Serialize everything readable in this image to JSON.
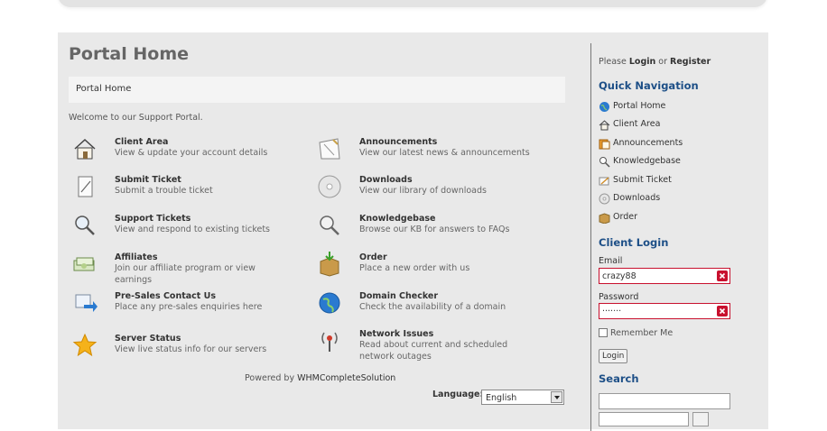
{
  "main": {
    "title": "Portal Home",
    "breadcrumb": "Portal Home",
    "welcome": "Welcome to our Support Portal.",
    "features": [
      {
        "title": "Client Area",
        "desc": "View & update your account details",
        "icon": "house-icon"
      },
      {
        "title": "Announcements",
        "desc": "View our latest news & announcements",
        "icon": "announcement-icon"
      },
      {
        "title": "Submit Ticket",
        "desc": "Submit a trouble ticket",
        "icon": "notepad-icon"
      },
      {
        "title": "Downloads",
        "desc": "View our library of downloads",
        "icon": "disc-icon"
      },
      {
        "title": "Support Tickets",
        "desc": "View and respond to existing tickets",
        "icon": "magnifier-icon"
      },
      {
        "title": "Knowledgebase",
        "desc": "Browse our KB for answers to FAQs",
        "icon": "magnifier-icon"
      },
      {
        "title": "Affiliates",
        "desc": "Join our affiliate program or view earnings",
        "icon": "money-icon"
      },
      {
        "title": "Order",
        "desc": "Place a new order with us",
        "icon": "package-icon"
      },
      {
        "title": "Pre-Sales Contact Us",
        "desc": "Place any pre-sales enquiries here",
        "icon": "send-icon"
      },
      {
        "title": "Domain Checker",
        "desc": "Check the availability of a domain",
        "icon": "globe-icon"
      },
      {
        "title": "Server Status",
        "desc": "View live status info for our servers",
        "icon": "star-icon"
      },
      {
        "title": "Network Issues",
        "desc": "Read about current and scheduled network outages",
        "icon": "broadcast-icon"
      }
    ],
    "powered_prefix": "Powered by ",
    "powered_brand": "WHMCompleteSolution",
    "language_label": "Language:",
    "language_value": "English"
  },
  "sidebar": {
    "please": "Please ",
    "login": "Login",
    "or": " or ",
    "register": "Register",
    "quick_nav_heading": "Quick Navigation",
    "nav": [
      {
        "label": "Portal Home",
        "icon": "globe-icon"
      },
      {
        "label": "Client Area",
        "icon": "house-icon"
      },
      {
        "label": "Announcements",
        "icon": "announcement-icon"
      },
      {
        "label": "Knowledgebase",
        "icon": "magnifier-icon"
      },
      {
        "label": "Submit Ticket",
        "icon": "ticket-icon"
      },
      {
        "label": "Downloads",
        "icon": "disc-icon"
      },
      {
        "label": "Order",
        "icon": "package-icon"
      }
    ],
    "client_login_heading": "Client Login",
    "email_label": "Email",
    "email_value": "crazy88",
    "password_label": "Password",
    "password_value": "·······",
    "remember_label": "Remember Me",
    "login_button": "Login",
    "search_heading": "Search"
  },
  "colors": {
    "heading": "#1d4f87",
    "error": "#c8102e",
    "panel": "#e9e9e9"
  }
}
